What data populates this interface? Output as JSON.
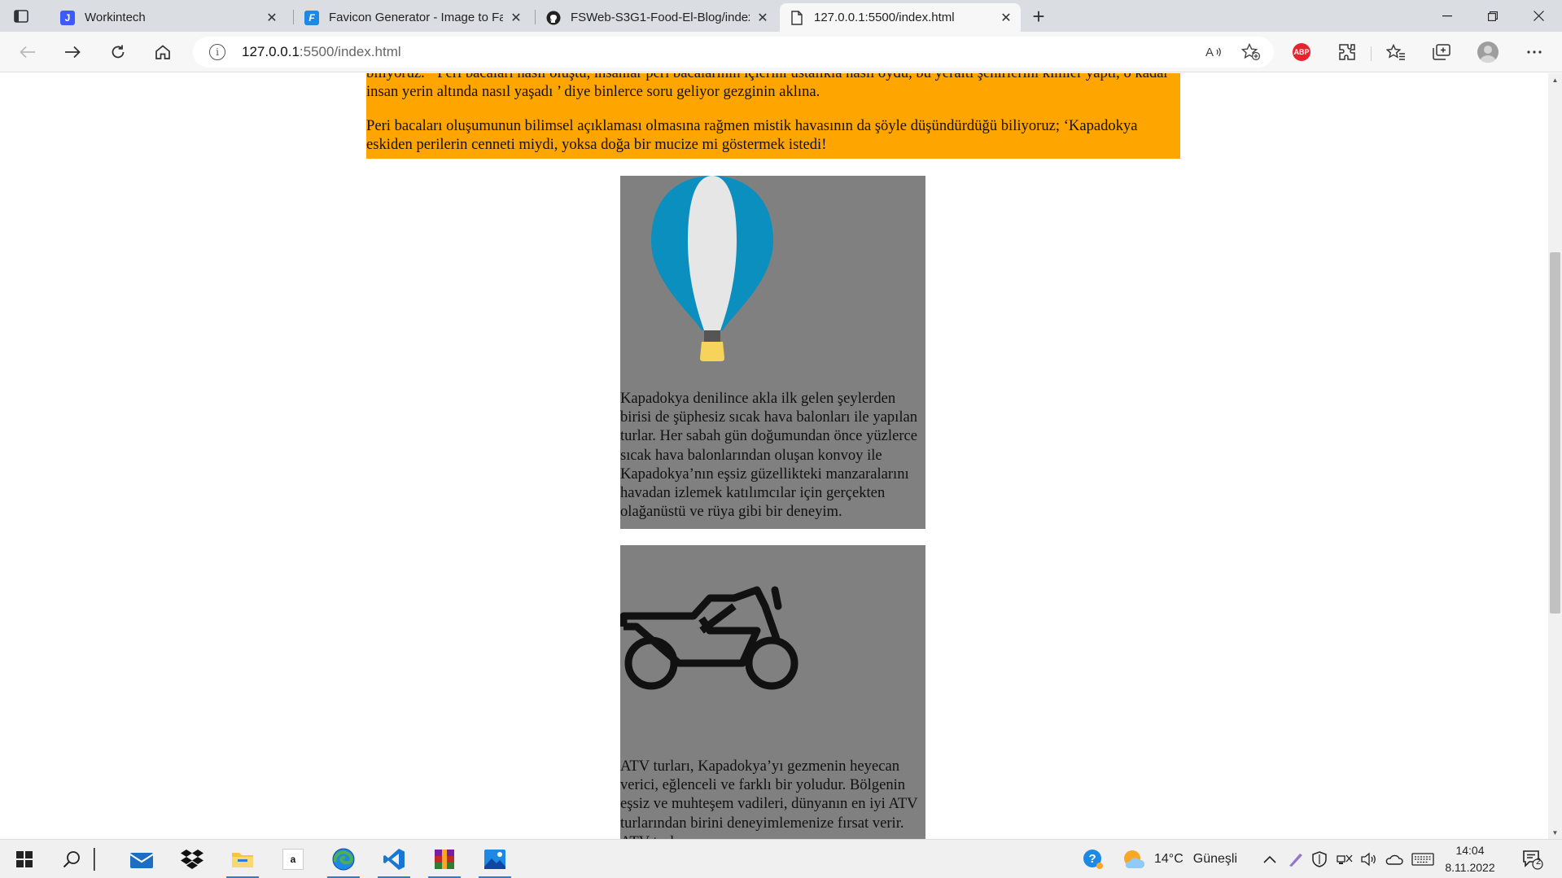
{
  "browser": {
    "tabs": [
      {
        "title": "Workintech",
        "favicon": "workintech-favicon",
        "active": false
      },
      {
        "title": "Favicon Generator - Image to Fav",
        "favicon": "favicon-generator-favicon",
        "active": false
      },
      {
        "title": "FSWeb-S3G1-Food-El-Blog/index",
        "favicon": "github-favicon",
        "active": false
      },
      {
        "title": "127.0.0.1:5500/index.html",
        "favicon": "page-favicon",
        "active": true
      }
    ],
    "address": {
      "host": "127.0.0.1",
      "path": ":5500/index.html"
    },
    "colors": {
      "abp": "#e8232f",
      "accent": "#2a7fd4"
    }
  },
  "page": {
    "intro_paragraphs": [
      "biliyoruz. ‘ Peri bacaları nasıl oluştu, insanlar peri bacalarının içlerini ustalıkla nasıl oydu, bu yeraltı şehirlerini kimler yaptı, o kadar insan yerin altında nasıl yaşadı ’ diye binlerce soru geliyor gezginin aklına.",
      "Peri bacaları oluşumunun bilimsel açıklaması olmasına rağmen mistik havasının da şöyle düşündürdüğü biliyoruz; ‘Kapadokya eskiden perilerin cenneti miydi, yoksa doğa bir mucize mi göstermek istedi!"
    ],
    "cards": [
      {
        "icon": "hot-air-balloon-icon",
        "text": "Kapadokya denilince akla ilk gelen şeylerden birisi de şüphesiz sıcak hava balonları ile yapılan turlar. Her sabah gün doğumundan önce yüzlerce sıcak hava balonlarından oluşan konvoy ile Kapadokya’nın eşsiz güzellikteki manzaralarını havadan izlemek katılımcılar için gerçekten olağanüstü ve rüya gibi bir deneyim."
      },
      {
        "icon": "motorcycle-icon",
        "text": "ATV turları, Kapadokya’yı gezmenin heyecan verici, eğlenceli ve farklı bir yoludur. Bölgenin eşsiz ve muhteşem vadileri, dünyanın en iyi ATV turlarından birini deneyimlemenize fırsat verir. ATV turlarının"
      }
    ],
    "colors": {
      "highlight": "#ffa500",
      "card_bg": "#808080"
    }
  },
  "taskbar": {
    "apps": [
      "start-icon",
      "search-icon",
      "mail-icon",
      "dropbox-icon",
      "file-explorer-icon",
      "amazon-icon",
      "edge-icon",
      "vscode-icon",
      "winrar-icon",
      "photos-icon"
    ],
    "weather": {
      "temp": "14°C",
      "condition": "Güneşli"
    },
    "clock": {
      "time": "14:04",
      "date": "8.11.2022"
    },
    "notifications": "2"
  }
}
